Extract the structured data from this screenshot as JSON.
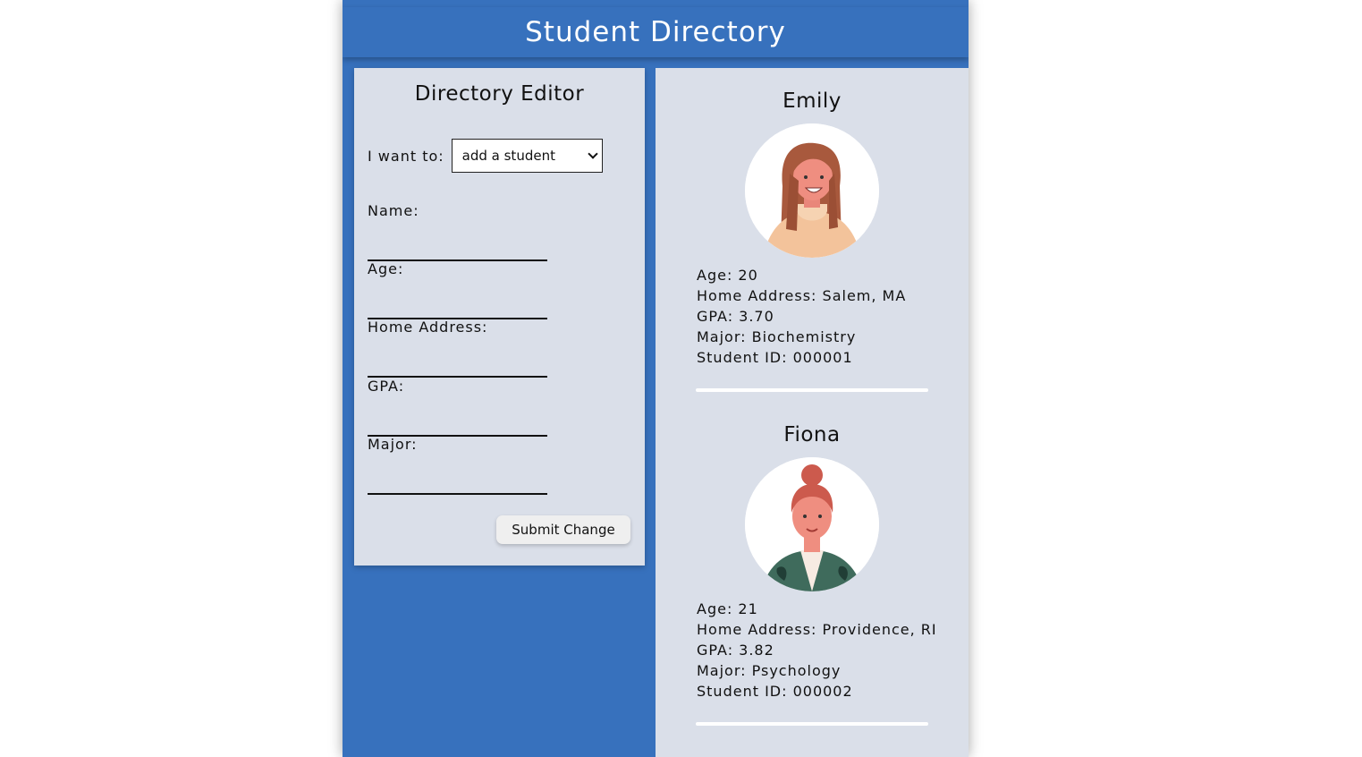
{
  "header": {
    "title": "Student Directory"
  },
  "editor": {
    "title": "Directory Editor",
    "action_label": "I want to:",
    "action_selected": "add a student",
    "fields": {
      "name_label": "Name:",
      "age_label": "Age:",
      "address_label": "Home Address:",
      "gpa_label": "GPA:",
      "major_label": "Major:"
    },
    "submit_label": "Submit Change"
  },
  "students": [
    {
      "name": "Emily",
      "age": "Age: 20",
      "address": "Home Address: Salem, MA",
      "gpa": "GPA: 3.70",
      "major": "Major: Biochemistry",
      "student_id": "Student ID: 000001"
    },
    {
      "name": "Fiona",
      "age": "Age: 21",
      "address": "Home Address: Providence, RI",
      "gpa": "GPA: 3.82",
      "major": "Major: Psychology",
      "student_id": "Student ID: 000002"
    }
  ],
  "colors": {
    "brand_blue": "#3771bd",
    "panel": "#dadfe9"
  }
}
